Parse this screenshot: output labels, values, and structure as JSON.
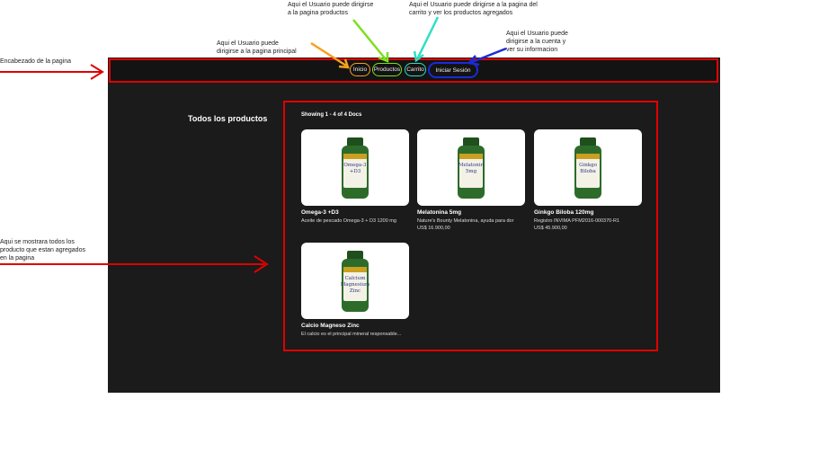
{
  "annotations": {
    "header_note": "Encabezado de la pagina",
    "home_note": [
      "Aqui el Usuario puede",
      "dirigirse a la pagina principal"
    ],
    "products_note": [
      "Aqui el Usuario puede dirigirse",
      "a la pagina productos"
    ],
    "cart_note": [
      "Aqui el Usuario puede dirigirse a la pagina del",
      "carrito y ver los productos agregados"
    ],
    "account_note": [
      "Aqui el Usuario puede",
      "dirigirse a la cuenta y",
      "ver su informacion"
    ],
    "products_area_note": [
      "Aqui se mostrara todos los",
      "producto que estan agregados",
      "en la pagina"
    ]
  },
  "nav": {
    "inicio": "Inicio",
    "productos": "Productos",
    "carrito": "Carrito",
    "login": "Iniciar Sesión"
  },
  "sidebar": {
    "title": "Todos los productos"
  },
  "results": {
    "showing": "Showing 1 - 4 of 4 Docs"
  },
  "products": [
    {
      "name": "Omega-3 +D3",
      "desc": "Aceite de pescado Omega-3 + D3 1200 mg",
      "price": "",
      "label": "Omega-3\n+D3"
    },
    {
      "name": "Melatonina 5mg",
      "desc": "Nature's Bounty Melatonina, ayuda para dor",
      "price": "US$ 16.900,00",
      "label": "Melatonin\n5mg"
    },
    {
      "name": "Ginkgo Biloba 120mg",
      "desc": "Registro INVIMA  PFM2016-000370-R1",
      "price": "US$ 45.900,00",
      "label": "Ginkgo\nBiloba"
    },
    {
      "name": "Calcio Magneso Zinc",
      "desc": "El calcio es el principal mineral responsable...",
      "price": "",
      "label": "Calcium\nMagnesium\nZinc"
    }
  ],
  "colors": {
    "highlight": "#e00000",
    "bottle": "#2d6b2a",
    "cap": "#1f4f1c",
    "home_arrow": "#f6a01c",
    "products_arrow": "#7be01e",
    "cart_arrow": "#2de0c4",
    "account_arrow": "#1b2bd6"
  }
}
